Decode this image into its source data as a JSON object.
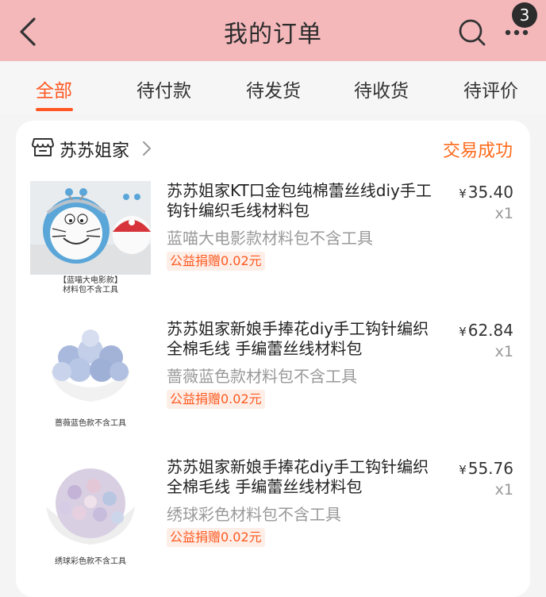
{
  "header": {
    "title": "我的订单",
    "badge_count": "3"
  },
  "tabs": [
    {
      "label": "全部",
      "active": true
    },
    {
      "label": "待付款"
    },
    {
      "label": "待发货"
    },
    {
      "label": "待收货"
    },
    {
      "label": "待评价"
    }
  ],
  "store": {
    "name": "苏苏姐家",
    "status": "交易成功"
  },
  "items": [
    {
      "title": "苏苏姐家KT口金包纯棉蕾丝线diy手工钩针编织毛线材料包",
      "sku": "蓝喵大电影款材料包不含工具",
      "donation": "公益捐赠0.02元",
      "currency": "¥",
      "price": "35.40",
      "qty": "x1",
      "thumb_caption_1": "【蓝喵大电影款】",
      "thumb_caption_2": "材料包不含工具"
    },
    {
      "title": "苏苏姐家新娘手捧花diy手工钩针编织全棉毛线 手编蕾丝线材料包",
      "sku": "蔷薇蓝色款材料包不含工具",
      "donation": "公益捐赠0.02元",
      "currency": "¥",
      "price": "62.84",
      "qty": "x1",
      "thumb_caption_1": "蔷薇蓝色款不含工具"
    },
    {
      "title": "苏苏姐家新娘手捧花diy手工钩针编织全棉毛线 手编蕾丝线材料包",
      "sku": "绣球彩色材料包不含工具",
      "donation": "公益捐赠0.02元",
      "currency": "¥",
      "price": "55.76",
      "qty": "x1",
      "thumb_caption_1": "绣球彩色款不含工具"
    }
  ],
  "colors": {
    "header_bg": "#f4b8bb",
    "accent": "#ff5722",
    "status": "#ff6a1a"
  }
}
